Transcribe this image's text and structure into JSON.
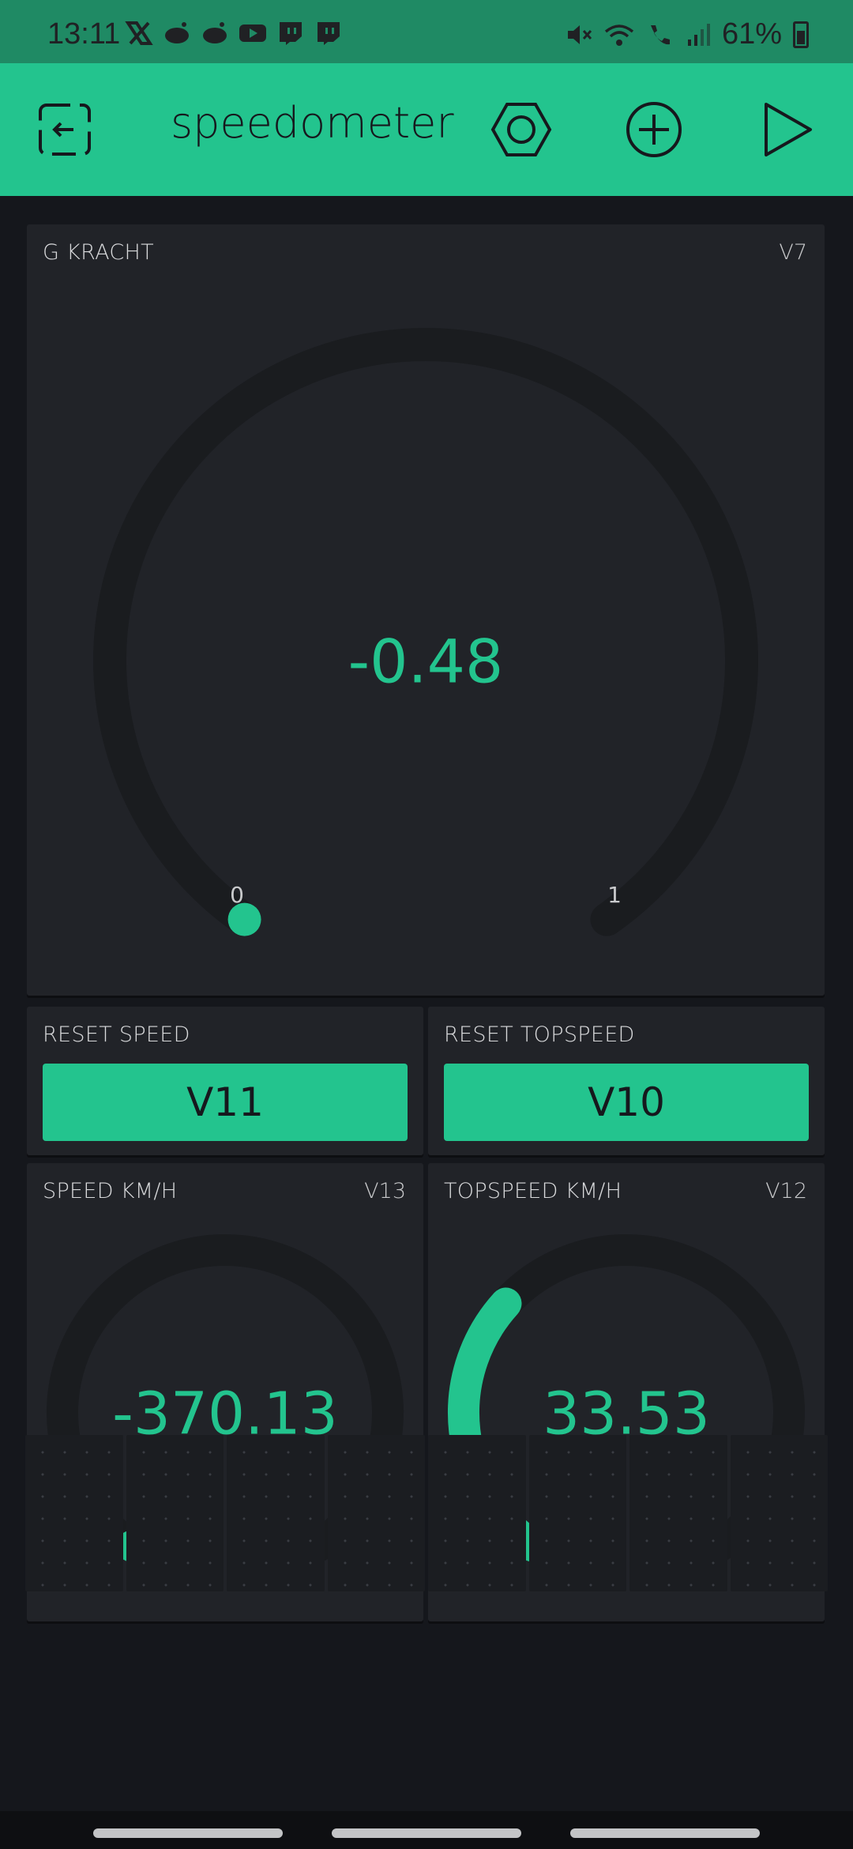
{
  "status_bar": {
    "time": "13:11",
    "battery": "61%",
    "app_icons": [
      "x-icon",
      "reddit-icon",
      "reddit-icon",
      "youtube-icon",
      "twitch-icon",
      "twitch-icon"
    ],
    "system_icons": [
      "mute-icon",
      "wifi-icon",
      "wifi-calling-icon",
      "signal-icon",
      "battery-icon"
    ]
  },
  "toolbar": {
    "title": "speedometer",
    "icons": [
      "exit-icon",
      "settings-hexagon-icon",
      "add-circle-icon",
      "play-icon"
    ]
  },
  "widgets": {
    "g_kracht": {
      "label": "G KRACHT",
      "pin": "V7",
      "value": "-0.48",
      "min": "0",
      "max": "1",
      "fill_fraction": 0.0
    },
    "reset_speed": {
      "label": "RESET SPEED",
      "button": "V11"
    },
    "reset_topspeed": {
      "label": "RESET TOPSPEED",
      "button": "V10"
    },
    "speed": {
      "label": "SPEED KM/H",
      "pin": "V13",
      "value": "-370.13",
      "min": "0",
      "max": "100",
      "fill_fraction": 0.0
    },
    "topspeed": {
      "label": "TOPSPEED KM/H",
      "pin": "V12",
      "value": "33.53",
      "min": "0",
      "max": "100",
      "fill_fraction": 0.3353
    }
  },
  "colors": {
    "accent": "#23c48e",
    "background": "#15171c",
    "widget_bg": "#212328",
    "track": "#1a1c1f"
  }
}
